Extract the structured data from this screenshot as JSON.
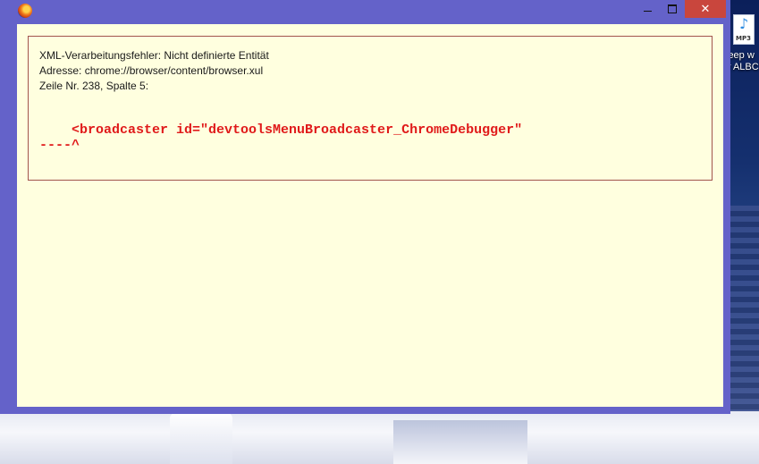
{
  "window": {
    "controls": {
      "minimize": "",
      "maximize": "",
      "close": "✕"
    }
  },
  "error": {
    "title": "XML-Verarbeitungsfehler: Nicht definierte Entität",
    "address": "Adresse: chrome://browser/content/browser.xul",
    "location": "Zeile Nr. 238, Spalte 5:",
    "source_line": "    <broadcaster id=\"devtoolsMenuBroadcaster_ChromeDebugger\"",
    "pointer_line": "----^"
  },
  "desktop": {
    "icon": {
      "type_tag": "MP3",
      "label_line1": "leep w",
      "label_line2": "y ALBC"
    }
  },
  "colors": {
    "window_frame": "#6462c9",
    "content_background": "#ffffdf",
    "error_border": "#a2544e",
    "source_text": "#e01a1a",
    "close_button": "#c9463d"
  }
}
